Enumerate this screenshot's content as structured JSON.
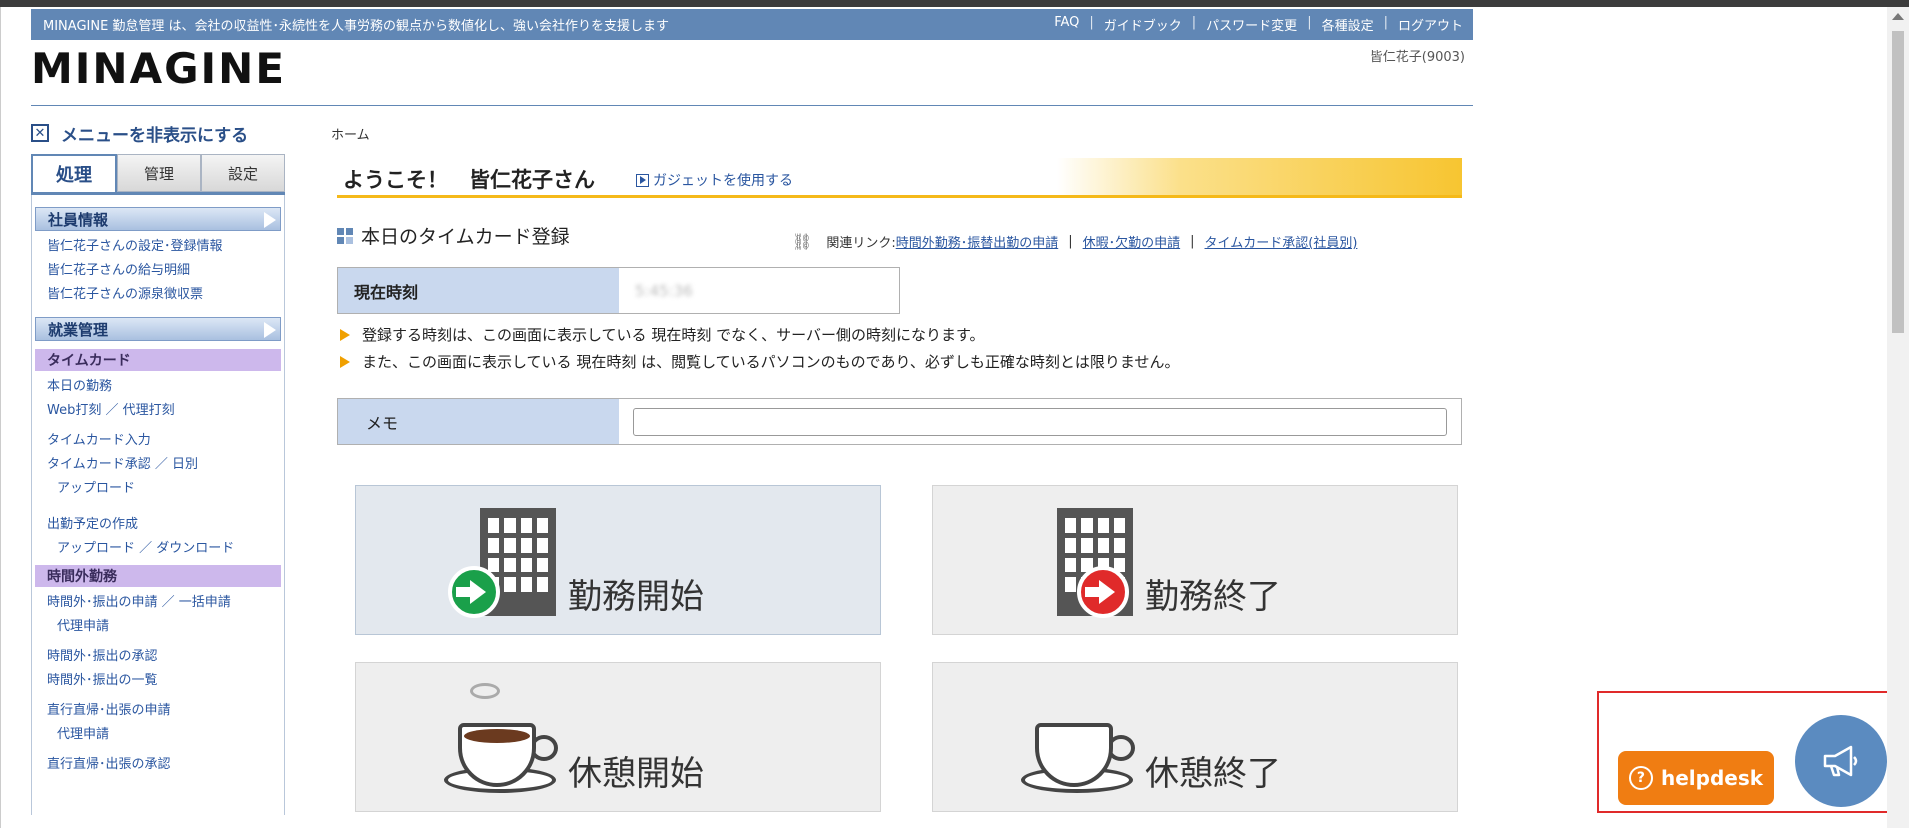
{
  "banner": {
    "tagline": "MINAGINE 勤怠管理 は、会社の収益性･永続性を人事労務の観点から数値化し、強い会社作りを支援します",
    "links": [
      "FAQ",
      "ガイドブック",
      "パスワード変更",
      "各種設定",
      "ログアウト"
    ]
  },
  "logo": "MINAGINE",
  "user": "皆仁花子(9003)",
  "sidebar": {
    "hide_menu": "メニューを非表示にする",
    "tabs": [
      "処理",
      "管理",
      "設定"
    ],
    "employee_section": "社員情報",
    "employee_links": [
      "皆仁花子さんの設定･登録情報",
      "皆仁花子さんの給与明細",
      "皆仁花子さんの源泉徴収票"
    ],
    "work_section": "就業管理",
    "timecard_head": "タイムカード",
    "timecard_links": [
      "本日の勤務",
      "Web打刻 ／ 代理打刻",
      "タイムカード入力",
      "タイムカード承認 ／ 日別",
      "アップロード",
      "出勤予定の作成",
      "アップロード ／ ダウンロード"
    ],
    "overtime_head": "時間外勤務",
    "overtime_links": [
      "時間外･振出の申請 ／ 一括申請",
      "代理申請",
      "時間外･振出の承認",
      "時間外･振出の一覧",
      "直行直帰･出張の申請",
      "代理申請",
      "直行直帰･出張の承認"
    ]
  },
  "main": {
    "breadcrumb": "ホーム",
    "welcome": "ようこそ！　皆仁花子さん",
    "gadget": "ガジェットを使用する",
    "timecard_title": "本日のタイムカード登録",
    "related_label": "関連リンク:",
    "related_links": [
      "時間外勤務･振替出勤の申請",
      "休暇･欠勤の申請",
      "タイムカード承認(社員別)"
    ],
    "time_label": "現在時刻",
    "time_value": "5:45:36",
    "notes": [
      "登録する時刻は、この画面に表示している 現在時刻 でなく、サーバー側の時刻になります。",
      "また、この画面に表示している 現在時刻 は、閲覧しているパソコンのものであり、必ずしも正確な時刻とは限りません。"
    ],
    "memo_label": "メモ",
    "memo_value": "",
    "buttons": [
      "勤務開始",
      "勤務終了",
      "休憩開始",
      "休憩終了"
    ]
  },
  "widget": {
    "helpdesk": "helpdesk"
  },
  "colors": {
    "banner": "#6187b5",
    "link": "#2a56a0",
    "helpdesk": "#f07d12",
    "announce": "#5b8bc0",
    "highlight_box": "#e02a2a"
  }
}
